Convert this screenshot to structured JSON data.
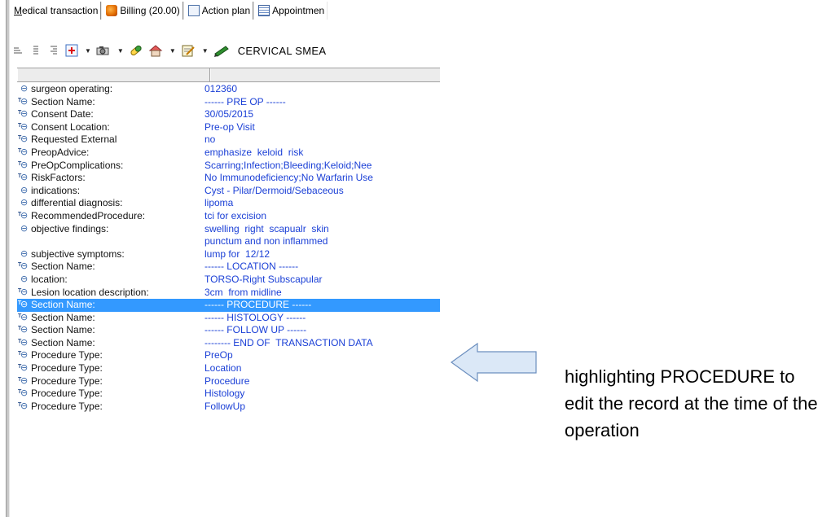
{
  "tabs": [
    {
      "label": "Medical transaction",
      "active": true,
      "icon": "none"
    },
    {
      "label": "Billing (20.00)",
      "icon": "billing-icon"
    },
    {
      "label": "Action plan",
      "icon": "action-plan-icon"
    },
    {
      "label": "Appointmen",
      "icon": "appointment-icon"
    }
  ],
  "toolbar": {
    "text": "CERVICAL SMEA"
  },
  "rows": [
    {
      "name": "surgeon operating:",
      "value": "012360",
      "template": false
    },
    {
      "name": "Section Name:",
      "value": "------ PRE OP ------",
      "template": true
    },
    {
      "name": "Consent Date:",
      "value": "30/05/2015",
      "template": true
    },
    {
      "name": "Consent Location:",
      "value": "Pre-op Visit",
      "template": true
    },
    {
      "name": "Requested  External",
      "value": "no",
      "template": true
    },
    {
      "name": "PreopAdvice:",
      "value": "emphasize  keloid  risk",
      "template": true
    },
    {
      "name": "PreOpComplications:",
      "value": "Scarring;Infection;Bleeding;Keloid;Nee",
      "template": true
    },
    {
      "name": "RiskFactors:",
      "value": "No Immunodeficiency;No Warfarin Use",
      "template": true
    },
    {
      "name": "indications:",
      "value": "Cyst - Pilar/Dermoid/Sebaceous",
      "template": false
    },
    {
      "name": "differential diagnosis:",
      "value": "lipoma",
      "template": false
    },
    {
      "name": "RecommendedProcedure:",
      "value": "tci for excision",
      "template": true
    },
    {
      "name": "objective findings:",
      "value": "swelling  right  scapualr  skin\npunctum and non inflammed",
      "template": false,
      "multi": true
    },
    {
      "name": "subjective symptoms:",
      "value": "lump for  12/12",
      "template": false
    },
    {
      "name": "Section Name:",
      "value": "------ LOCATION ------",
      "template": true
    },
    {
      "name": "location:",
      "value": "TORSO-Right Subscapular",
      "template": false
    },
    {
      "name": "Lesion location description:",
      "value": "3cm  from midline",
      "template": true
    },
    {
      "name": "Section Name:",
      "value": "------ PROCEDURE ------",
      "template": true,
      "selected": true
    },
    {
      "name": "Section Name:",
      "value": "------ HISTOLOGY ------",
      "template": true
    },
    {
      "name": "Section Name:",
      "value": "------ FOLLOW UP ------",
      "template": true
    },
    {
      "name": "Section Name:",
      "value": "-------- END OF  TRANSACTION DATA",
      "template": true
    },
    {
      "name": "Procedure Type:",
      "value": "PreOp",
      "template": true
    },
    {
      "name": "Procedure Type:",
      "value": "Location",
      "template": true
    },
    {
      "name": "Procedure Type:",
      "value": "Procedure",
      "template": true
    },
    {
      "name": "Procedure Type:",
      "value": "Histology",
      "template": true
    },
    {
      "name": "Procedure Type:",
      "value": "FollowUp",
      "template": true
    }
  ],
  "annotation": {
    "text": "highlighting PROCEDURE to edit the record at the time of the operation",
    "arrow_color": "#dbe8f7",
    "arrow_border": "#6c8fbf"
  },
  "colors": {
    "value_text": "#1a3fd6",
    "selection": "#3399ff"
  }
}
